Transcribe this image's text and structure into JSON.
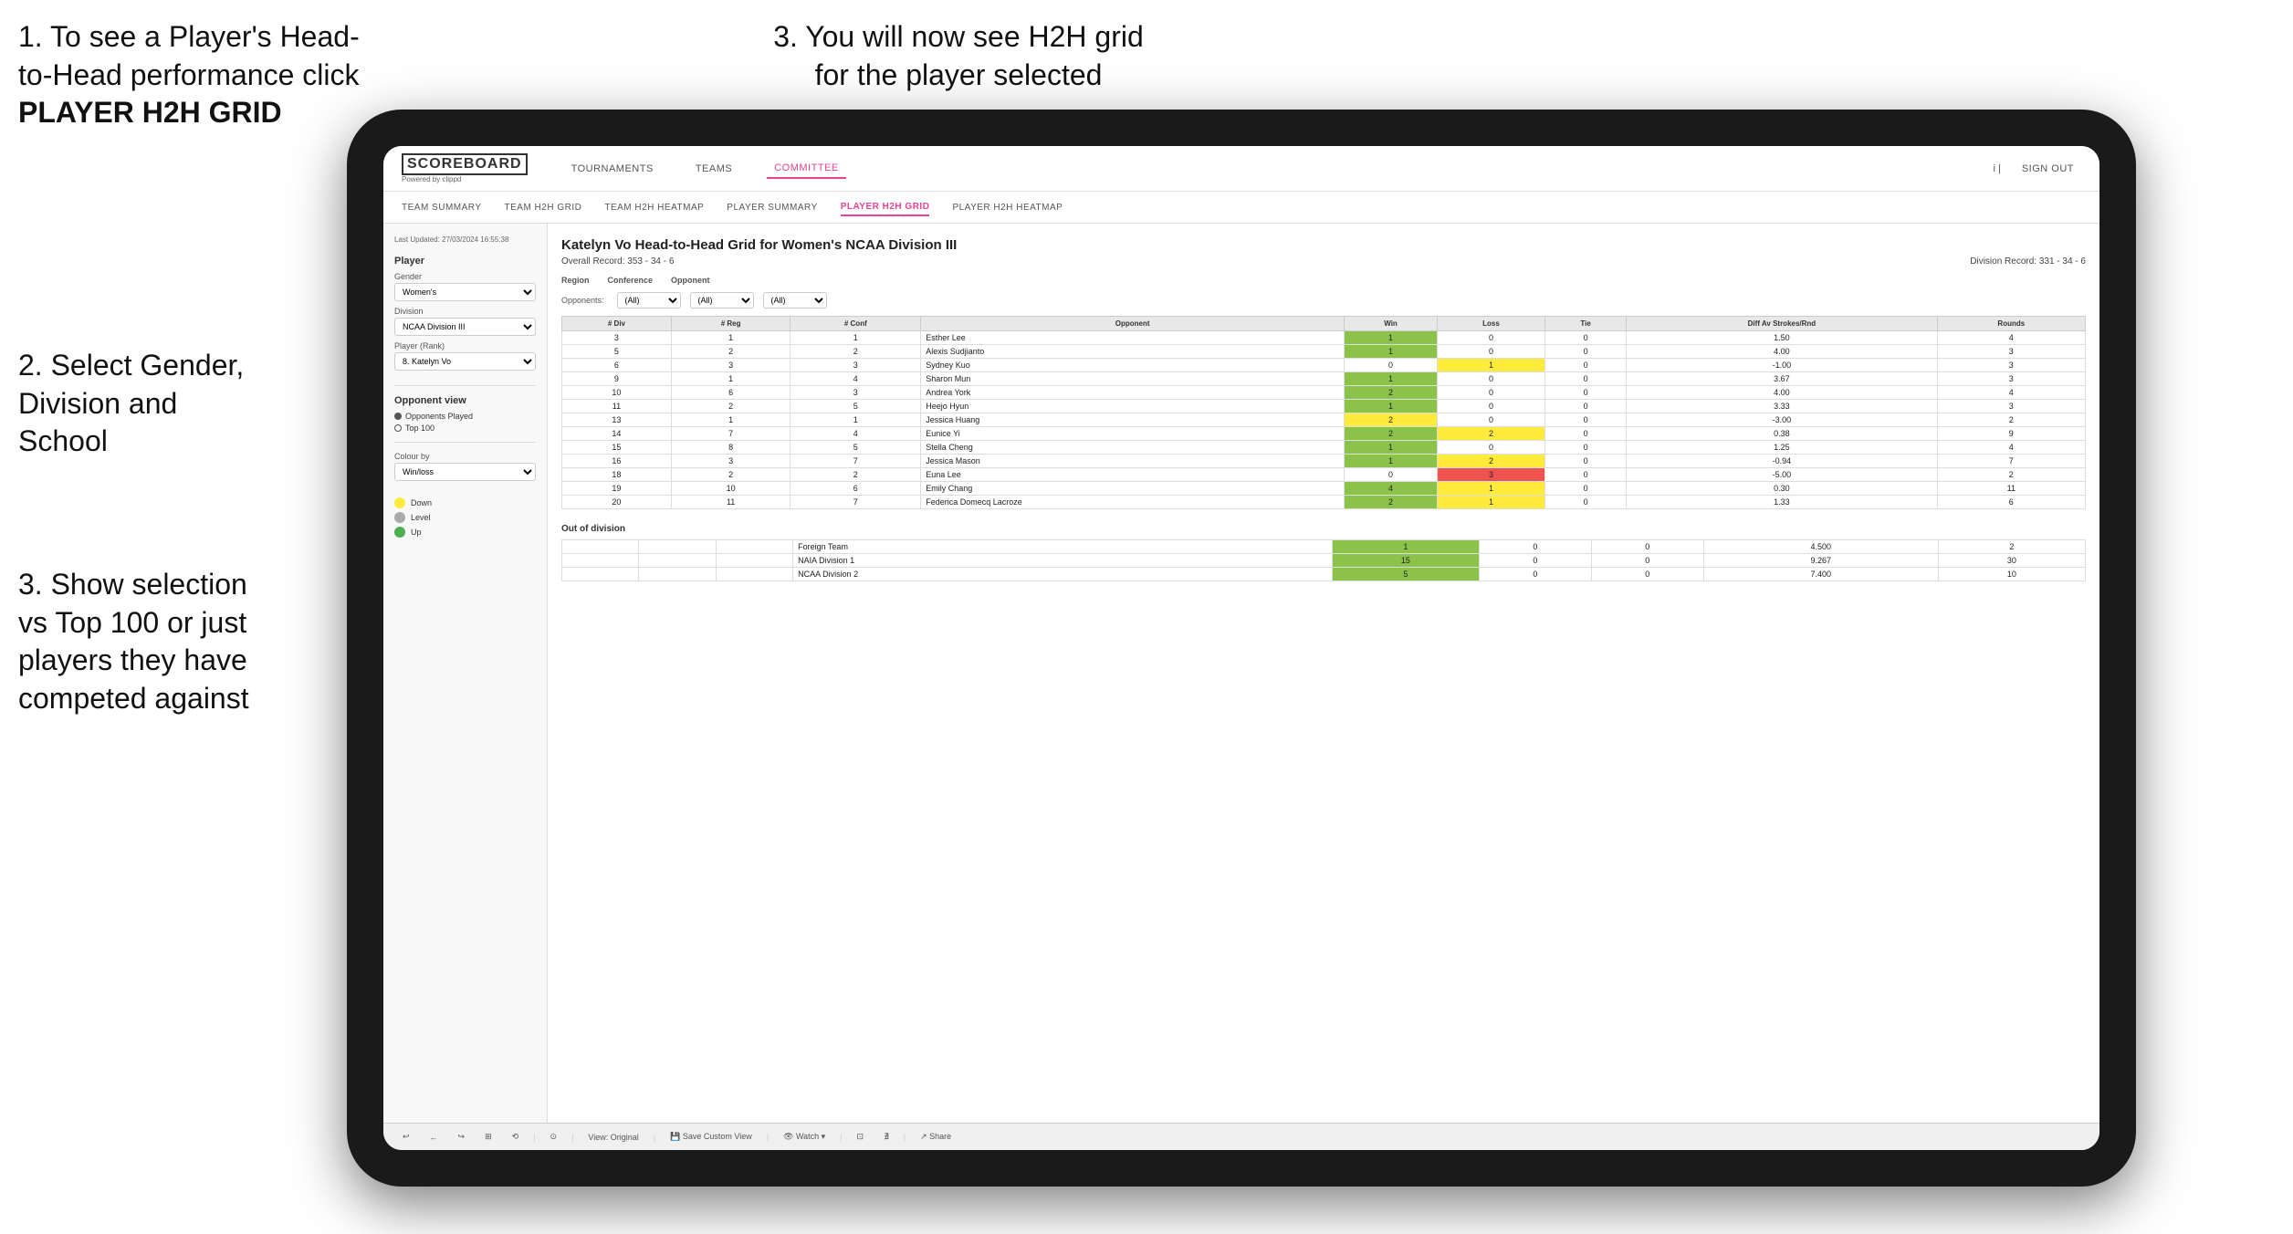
{
  "instructions": {
    "step1_line1": "1. To see a Player's Head-",
    "step1_line2": "to-Head performance click",
    "step1_bold": "PLAYER H2H GRID",
    "step3_top_line1": "3. You will now see H2H grid",
    "step3_top_line2": "for the player selected",
    "step2_line1": "2. Select Gender,",
    "step2_line2": "Division and",
    "step2_line3": "School",
    "step3_bot_line1": "3. Show selection",
    "step3_bot_line2": "vs Top 100 or just",
    "step3_bot_line3": "players they have",
    "step3_bot_line4": "competed against"
  },
  "navbar": {
    "logo": "SCOREBOARD",
    "logo_sub": "Powered by clippd",
    "nav_items": [
      "TOURNAMENTS",
      "TEAMS",
      "COMMITTEE"
    ],
    "nav_sign_in": "Sign out",
    "nav_divider": "i |"
  },
  "subnav": {
    "items": [
      "TEAM SUMMARY",
      "TEAM H2H GRID",
      "TEAM H2H HEATMAP",
      "PLAYER SUMMARY",
      "PLAYER H2H GRID",
      "PLAYER H2H HEATMAP"
    ],
    "active": "PLAYER H2H GRID"
  },
  "sidebar": {
    "timestamp": "Last Updated: 27/03/2024\n16:55:38",
    "player_label": "Player",
    "gender_label": "Gender",
    "gender_value": "Women's",
    "division_label": "Division",
    "division_value": "NCAA Division III",
    "player_rank_label": "Player (Rank)",
    "player_rank_value": "8. Katelyn Vo",
    "opponent_view_label": "Opponent view",
    "opponent_options": [
      "Opponents Played",
      "Top 100"
    ],
    "opponent_selected": "Opponents Played",
    "colour_by_label": "Colour by",
    "colour_by_value": "Win/loss",
    "legend": [
      {
        "color": "#ffeb3b",
        "label": "Down"
      },
      {
        "color": "#aaaaaa",
        "label": "Level"
      },
      {
        "color": "#4caf50",
        "label": "Up"
      }
    ]
  },
  "grid": {
    "title": "Katelyn Vo Head-to-Head Grid for Women's NCAA Division III",
    "overall_record_label": "Overall Record:",
    "overall_record": "353 - 34 - 6",
    "division_record_label": "Division Record:",
    "division_record": "331 - 34 - 6",
    "filter_region_label": "Region",
    "filter_conf_label": "Conference",
    "filter_opp_label": "Opponent",
    "filter_opponents_label": "Opponents:",
    "filter_all": "(All)",
    "columns": [
      "# Div",
      "# Reg",
      "# Conf",
      "Opponent",
      "Win",
      "Loss",
      "Tie",
      "Diff Av Strokes/Rnd",
      "Rounds"
    ],
    "rows": [
      {
        "div": 3,
        "reg": 1,
        "conf": 1,
        "name": "Esther Lee",
        "win": 1,
        "loss": 0,
        "tie": 0,
        "diff": "1.50",
        "rounds": 4,
        "win_color": "green",
        "loss_color": "white",
        "tie_color": "white"
      },
      {
        "div": 5,
        "reg": 2,
        "conf": 2,
        "name": "Alexis Sudjianto",
        "win": 1,
        "loss": 0,
        "tie": 0,
        "diff": "4.00",
        "rounds": 3,
        "win_color": "green"
      },
      {
        "div": 6,
        "reg": 3,
        "conf": 3,
        "name": "Sydney Kuo",
        "win": 0,
        "loss": 1,
        "tie": 0,
        "diff": "-1.00",
        "rounds": 3,
        "win_color": "white",
        "loss_color": "yellow"
      },
      {
        "div": 9,
        "reg": 1,
        "conf": 4,
        "name": "Sharon Mun",
        "win": 1,
        "loss": 0,
        "tie": 0,
        "diff": "3.67",
        "rounds": 3,
        "win_color": "green"
      },
      {
        "div": 10,
        "reg": 6,
        "conf": 3,
        "name": "Andrea York",
        "win": 2,
        "loss": 0,
        "tie": 0,
        "diff": "4.00",
        "rounds": 4,
        "win_color": "green"
      },
      {
        "div": 11,
        "reg": 2,
        "conf": 5,
        "name": "Heejo Hyun",
        "win": 1,
        "loss": 0,
        "tie": 0,
        "diff": "3.33",
        "rounds": 3,
        "win_color": "green"
      },
      {
        "div": 13,
        "reg": 1,
        "conf": 1,
        "name": "Jessica Huang",
        "win": 2,
        "loss": 0,
        "tie": 0,
        "diff": "-3.00",
        "rounds": 2,
        "win_color": "yellow"
      },
      {
        "div": 14,
        "reg": 7,
        "conf": 4,
        "name": "Eunice Yi",
        "win": 2,
        "loss": 2,
        "tie": 0,
        "diff": "0.38",
        "rounds": 9,
        "win_color": "green",
        "loss_color": "yellow"
      },
      {
        "div": 15,
        "reg": 8,
        "conf": 5,
        "name": "Stella Cheng",
        "win": 1,
        "loss": 0,
        "tie": 0,
        "diff": "1.25",
        "rounds": 4,
        "win_color": "green"
      },
      {
        "div": 16,
        "reg": 3,
        "conf": 7,
        "name": "Jessica Mason",
        "win": 1,
        "loss": 2,
        "tie": 0,
        "diff": "-0.94",
        "rounds": 7,
        "win_color": "green",
        "loss_color": "yellow"
      },
      {
        "div": 18,
        "reg": 2,
        "conf": 2,
        "name": "Euna Lee",
        "win": 0,
        "loss": 3,
        "tie": 0,
        "diff": "-5.00",
        "rounds": 2,
        "win_color": "white",
        "loss_color": "red"
      },
      {
        "div": 19,
        "reg": 10,
        "conf": 6,
        "name": "Emily Chang",
        "win": 4,
        "loss": 1,
        "tie": 0,
        "diff": "0.30",
        "rounds": 11,
        "win_color": "green",
        "loss_color": "yellow"
      },
      {
        "div": 20,
        "reg": 11,
        "conf": 7,
        "name": "Federica Domecq Lacroze",
        "win": 2,
        "loss": 1,
        "tie": 0,
        "diff": "1.33",
        "rounds": 6,
        "win_color": "green",
        "loss_color": "yellow"
      }
    ],
    "out_of_division_label": "Out of division",
    "out_of_division_rows": [
      {
        "name": "Foreign Team",
        "win": 1,
        "loss": 0,
        "tie": 0,
        "diff": "4.500",
        "rounds": 2,
        "win_color": "green"
      },
      {
        "name": "NAIA Division 1",
        "win": 15,
        "loss": 0,
        "tie": 0,
        "diff": "9.267",
        "rounds": 30,
        "win_color": "green"
      },
      {
        "name": "NCAA Division 2",
        "win": 5,
        "loss": 0,
        "tie": 0,
        "diff": "7.400",
        "rounds": 10,
        "win_color": "green"
      }
    ]
  },
  "toolbar": {
    "buttons": [
      "↩",
      "←",
      "↪",
      "⊞",
      "⟲",
      "·",
      "⊙",
      "View: Original",
      "Save Custom View",
      "Watch ▾",
      "⊡·",
      "∄",
      "Share"
    ]
  }
}
